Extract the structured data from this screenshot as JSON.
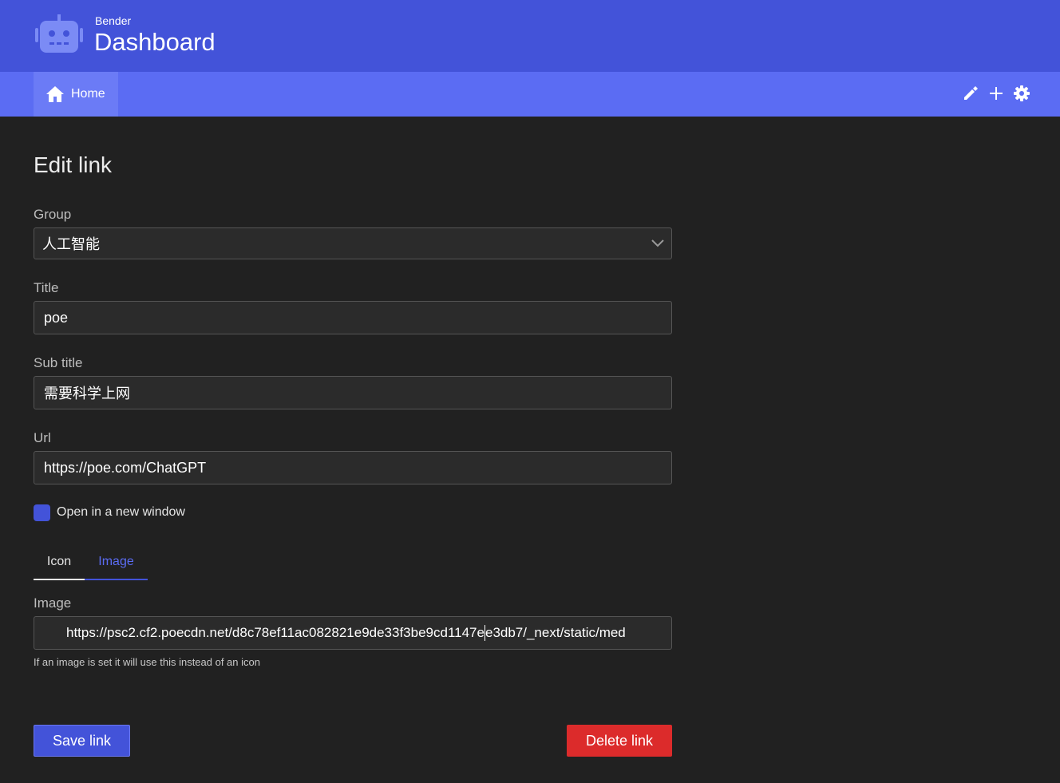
{
  "header": {
    "brand_sub": "Bender",
    "brand_title": "Dashboard",
    "logo_icon": "robot-icon",
    "color": "#4353d9"
  },
  "nav": {
    "home_label": "Home",
    "home_icon": "home-icon",
    "actions": [
      "pencil-icon",
      "plus-icon",
      "gear-icon"
    ],
    "color": "#5b6cf3"
  },
  "form": {
    "title": "Edit link",
    "group": {
      "label": "Group",
      "value": "人工智能"
    },
    "title_field": {
      "label": "Title",
      "value": "poe"
    },
    "subtitle": {
      "label": "Sub title",
      "value": "需要科学上网"
    },
    "url": {
      "label": "Url",
      "value": "https://poe.com/ChatGPT"
    },
    "new_window": {
      "label": "Open in a new window",
      "checked": true
    },
    "tabs": [
      {
        "label": "Icon",
        "active": false
      },
      {
        "label": "Image",
        "active": true
      }
    ],
    "image": {
      "label": "Image",
      "value_before_caret": "https://psc2.cf2.poecdn.net/d8c78ef11ac082821e9de33f3be9cd1147e",
      "value_after_caret": "e3db7/_next/static/med",
      "help": "If an image is set it will use this instead of an icon"
    },
    "save_label": "Save link",
    "delete_label": "Delete link"
  },
  "colors": {
    "primary": "#4353d9",
    "danger": "#dc2b2b",
    "background": "#212121"
  }
}
